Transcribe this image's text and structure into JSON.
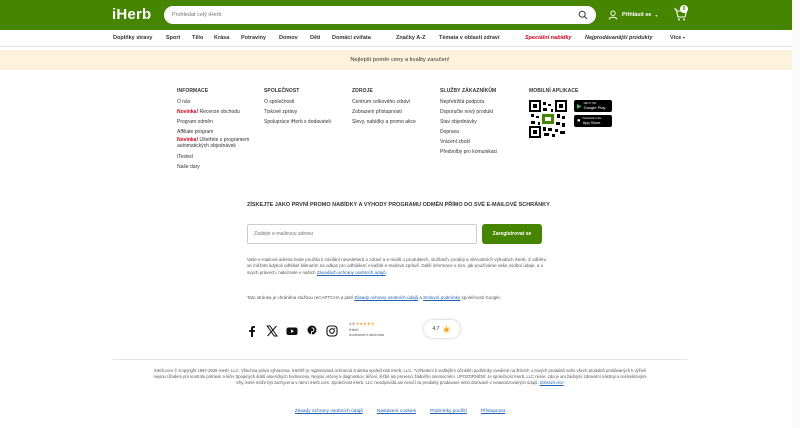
{
  "header": {
    "logo": "iHerb",
    "search_placeholder": "Prohledat celý iHerb",
    "signin_label": "Přihlásit se",
    "cart_count": "0"
  },
  "nav": {
    "items": [
      {
        "label": "Doplňky stravy"
      },
      {
        "label": "Sport"
      },
      {
        "label": "Tělo"
      },
      {
        "label": "Krása"
      },
      {
        "label": "Potraviny"
      },
      {
        "label": "Domov"
      },
      {
        "label": "Děti"
      },
      {
        "label": "Domácí zvířata"
      },
      {
        "label": "Značky A-Z"
      },
      {
        "label": "Témata v oblasti zdraví"
      },
      {
        "label": "Speciální nabídky"
      },
      {
        "label": "Nejprodávanější produkty"
      },
      {
        "label": "Více"
      }
    ]
  },
  "banner": {
    "text": "Nejlepší poměr ceny a kvality zaručen!"
  },
  "footer": {
    "columns": [
      {
        "title": "INFORMACE",
        "items": [
          {
            "label": "O nás"
          },
          {
            "label": "Recenze obchodu",
            "badge": "Novinka!"
          },
          {
            "label": "Program odměn"
          },
          {
            "label": "Affiliate program"
          },
          {
            "label": "Ušetřete s programem automatických objednávek",
            "badge": "Novinka!"
          },
          {
            "label": "iTested"
          },
          {
            "label": "Naše dary"
          }
        ]
      },
      {
        "title": "SPOLEČNOST",
        "items": [
          {
            "label": "O společnosti"
          },
          {
            "label": "Tiskové zprávy"
          },
          {
            "label": "Spolupráce iHerb s dodavateli"
          }
        ]
      },
      {
        "title": "ZDROJE",
        "items": [
          {
            "label": "Centrum celkového zdraví"
          },
          {
            "label": "Zobrazení přístupnosti"
          },
          {
            "label": "Slevy, nabídky a promo akce"
          }
        ]
      },
      {
        "title": "SLUŽBY ZÁKAZNÍKŮM",
        "items": [
          {
            "label": "Nepřetržitá podpora"
          },
          {
            "label": "Doporučte nový produkt"
          },
          {
            "label": "Stav objednávky"
          },
          {
            "label": "Doprava"
          },
          {
            "label": "Vrácení zboží"
          },
          {
            "label": "Předvolby pro komunikaci"
          }
        ]
      },
      {
        "title": "MOBILNÍ APLIKACE",
        "items": []
      }
    ],
    "apps": {
      "google": "Google Play",
      "apple": "App Store",
      "google_pre": "GET IT ON",
      "apple_pre": "Download on the"
    }
  },
  "newsletter": {
    "title": "ZÍSKEJTE JAKO PRVNÍ PROMO NABÍDKY A VÝHODY PROGRAMU ODMĚN PŘÍMO DO SVÉ E-MAILOVÉ SCHRÁNKY",
    "input_placeholder": "Zadejte e-mailovou adresu",
    "button": "Zaregistrovat se",
    "disclaimer": "Vaše e-mailová adresa bude použita k zasílání newsletterů o zdraví a e-mailů o produktech, službách, prodeji a věrnostních výhodách iHerb. Z odběru se můžete kdykoli odhlásit kliknutím na odkaz pro odhlášení v každé e-mailové zprávě. Další informace o tom, jak používáme vaše osobní údaje, a o svých právech, naleznete v našich",
    "disclaimer_link": "Zásadách ochrany osobních údajů",
    "captcha_pre": "Tato stránka je chráněna službou reCAPTCHA a platí",
    "captcha_link1": "Zásady ochrany osobních údajů",
    "captcha_mid": "a",
    "captcha_link2": "Smluvní podmínky",
    "captcha_post": "společnosti Google."
  },
  "social": {
    "rating_value": "4.8",
    "rating_stars": "★★★★★",
    "rating_source": "iHerb",
    "rating_caption": "hodnocení obchodu",
    "chip_rating": "4.7"
  },
  "legal": {
    "text": "iHerb.com © Copyright 1997-2026 iHerb, LLC. Všechna práva vyhrazena. iHerb® je registrovaná ochranná známka společnosti iHerb, LLC. *Vzhledem k vedlejším účinkům podmínky uvedené na štítcích u nových produktů nebo všech produktů prodávaných k výživě nejsou Úřadem pro kontrolu potravin a léčiv Spojených států amerických hodnoceny. Nejsou určeny k diagnostice, léčení, léčbě ani prevenci žádného onemocnění. UPOZORNĚNÍ: Je společnost iHerb, LLC nevíe, zda je ani žádnými zdravotní nástroji a celosvětovými trhy, které může být zachycena v rámci iHerb.com. Společnost iHerb, LLC neodpovídá ani neručí za produkty prodávané nebo darované v neautorizovaných údajů.",
    "link": "Zobrazit více",
    "links": [
      "Zásady ochrany osobních údajů",
      "Nastavení cookies",
      "Podmínky použití",
      "Přístupnost"
    ]
  }
}
